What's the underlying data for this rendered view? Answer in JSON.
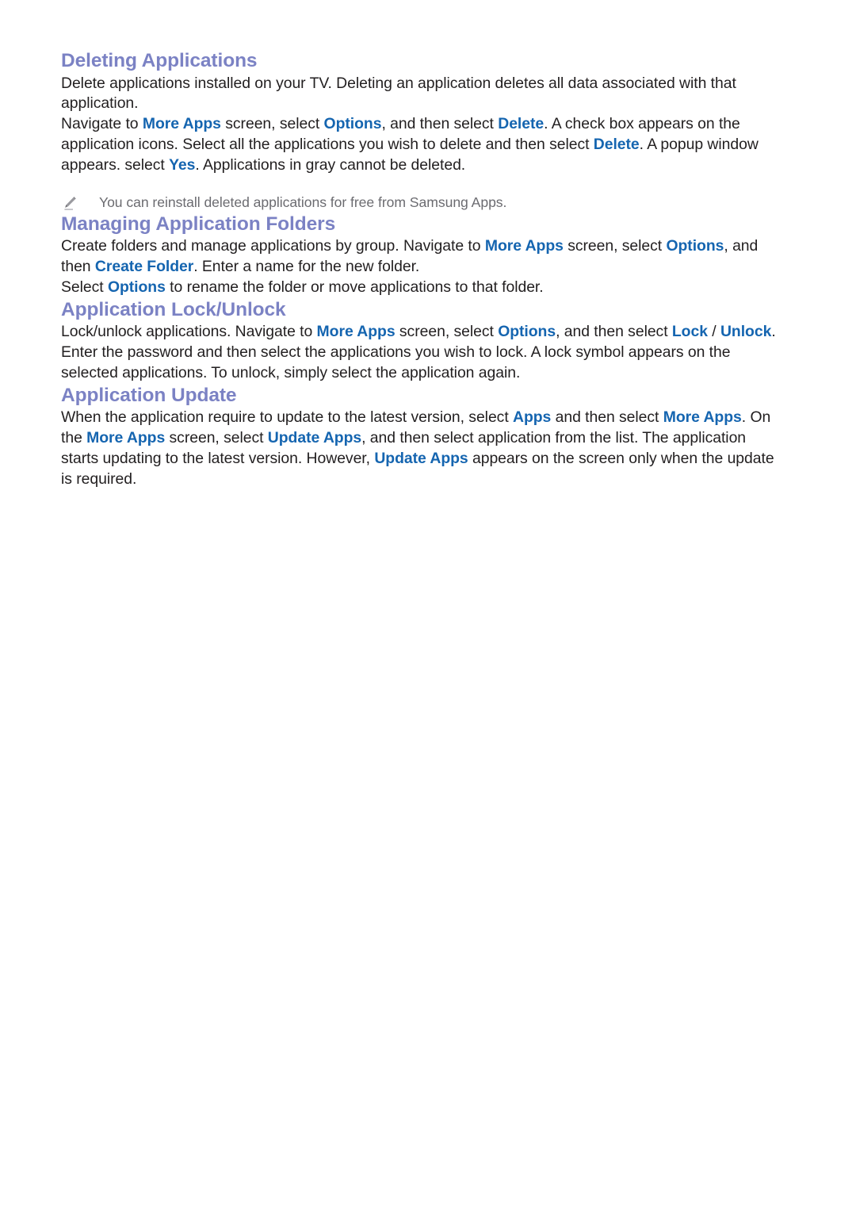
{
  "document": {
    "sections": [
      {
        "id": "deleting-applications",
        "heading": "Deleting Applications",
        "paragraphs": [
          {
            "id": "p-delete-intro",
            "runs": [
              {
                "text": "Delete applications installed on your TV. Deleting an application deletes all data associated with that application.",
                "style": "normal"
              }
            ]
          },
          {
            "id": "p-delete-steps",
            "runs": [
              {
                "text": "Navigate to ",
                "style": "normal"
              },
              {
                "text": "More Apps",
                "style": "highlight"
              },
              {
                "text": " screen, select ",
                "style": "normal"
              },
              {
                "text": "Options",
                "style": "highlight"
              },
              {
                "text": ", and then select ",
                "style": "normal"
              },
              {
                "text": "Delete",
                "style": "highlight"
              },
              {
                "text": ". A check box appears on the application icons. Select all the applications you wish to delete and then select ",
                "style": "normal"
              },
              {
                "text": "Delete",
                "style": "highlight"
              },
              {
                "text": ". A popup window appears. select ",
                "style": "normal"
              },
              {
                "text": "Yes",
                "style": "highlight"
              },
              {
                "text": ". Applications in gray cannot be deleted.",
                "style": "normal"
              }
            ]
          }
        ],
        "note": {
          "icon": "pencil-icon",
          "text": "You can reinstall deleted applications for free from Samsung Apps."
        }
      },
      {
        "id": "managing-application-folders",
        "heading": "Managing Application Folders",
        "paragraphs": [
          {
            "id": "p-folders-create",
            "runs": [
              {
                "text": "Create folders and manage applications by group. Navigate to ",
                "style": "normal"
              },
              {
                "text": "More Apps",
                "style": "highlight"
              },
              {
                "text": " screen, select ",
                "style": "normal"
              },
              {
                "text": "Options",
                "style": "highlight"
              },
              {
                "text": ", and then ",
                "style": "normal"
              },
              {
                "text": "Create Folder",
                "style": "highlight"
              },
              {
                "text": ". Enter a name for the new folder.",
                "style": "normal"
              }
            ]
          },
          {
            "id": "p-folders-rename",
            "runs": [
              {
                "text": "Select ",
                "style": "normal"
              },
              {
                "text": "Options",
                "style": "highlight"
              },
              {
                "text": " to rename the folder or move applications to that folder.",
                "style": "normal"
              }
            ]
          }
        ],
        "note": null
      },
      {
        "id": "application-lock-unlock",
        "heading": "Application Lock/Unlock",
        "paragraphs": [
          {
            "id": "p-lock-unlock",
            "runs": [
              {
                "text": "Lock/unlock applications. Navigate to ",
                "style": "normal"
              },
              {
                "text": "More Apps",
                "style": "highlight"
              },
              {
                "text": " screen, select ",
                "style": "normal"
              },
              {
                "text": "Options",
                "style": "highlight"
              },
              {
                "text": ", and then select ",
                "style": "normal"
              },
              {
                "text": "Lock",
                "style": "highlight"
              },
              {
                "text": " / ",
                "style": "normal"
              },
              {
                "text": "Unlock",
                "style": "highlight"
              },
              {
                "text": ". Enter the password and then select the applications you wish to lock. A lock symbol appears on the selected applications. To unlock, simply select the application again.",
                "style": "normal"
              }
            ]
          }
        ],
        "note": null
      },
      {
        "id": "application-update",
        "heading": "Application Update",
        "paragraphs": [
          {
            "id": "p-update",
            "runs": [
              {
                "text": "When the application require to update to the latest version, select ",
                "style": "normal"
              },
              {
                "text": "Apps",
                "style": "highlight"
              },
              {
                "text": " and then select ",
                "style": "normal"
              },
              {
                "text": "More Apps",
                "style": "highlight"
              },
              {
                "text": ". On the ",
                "style": "normal"
              },
              {
                "text": "More Apps",
                "style": "highlight"
              },
              {
                "text": " screen, select ",
                "style": "normal"
              },
              {
                "text": "Update Apps",
                "style": "highlight"
              },
              {
                "text": ", and then select application from the list. The application starts updating to the latest version. However, ",
                "style": "normal"
              },
              {
                "text": "Update Apps",
                "style": "highlight"
              },
              {
                "text": " appears on the screen only when the update is required.",
                "style": "normal"
              }
            ]
          }
        ],
        "note": null
      }
    ]
  },
  "colors": {
    "heading": "#7b82c4",
    "highlight": "#1565b0",
    "body": "#221f20",
    "note": "#6b6b70",
    "background": "#ffffff"
  }
}
